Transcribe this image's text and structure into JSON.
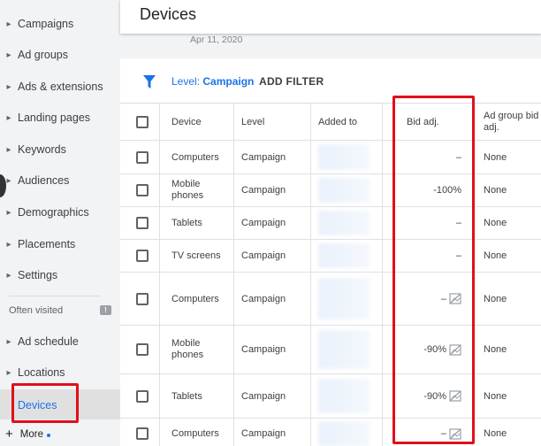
{
  "sidebar": {
    "items": [
      {
        "label": "Campaigns"
      },
      {
        "label": "Ad groups"
      },
      {
        "label": "Ads & extensions"
      },
      {
        "label": "Landing pages"
      },
      {
        "label": "Keywords"
      },
      {
        "label": "Audiences"
      },
      {
        "label": "Demographics"
      },
      {
        "label": "Placements"
      },
      {
        "label": "Settings"
      }
    ],
    "often_visited_label": "Often visited",
    "visited": [
      {
        "label": "Ad schedule"
      },
      {
        "label": "Locations"
      }
    ],
    "active_label": "Devices",
    "more_label": "More"
  },
  "header": {
    "title": "Devices",
    "date": "Apr 11, 2020"
  },
  "filter_bar": {
    "level_prefix": "Level:",
    "level_value": "Campaign",
    "add_filter": "ADD FILTER"
  },
  "table": {
    "columns": {
      "device": "Device",
      "level": "Level",
      "added_to": "Added to",
      "bid_adj": "Bid adj.",
      "ad_group_bid_line1": "Ad group bid",
      "ad_group_bid_line2": "adj."
    },
    "rows": [
      {
        "device": "Computers",
        "device2": "",
        "level": "Campaign",
        "bid": "–",
        "ad_group_bid": "None",
        "icon": false
      },
      {
        "device": "Mobile",
        "device2": "phones",
        "level": "Campaign",
        "bid": "-100%",
        "ad_group_bid": "None",
        "icon": false
      },
      {
        "device": "Tablets",
        "device2": "",
        "level": "Campaign",
        "bid": "–",
        "ad_group_bid": "None",
        "icon": false
      },
      {
        "device": "TV screens",
        "device2": "",
        "level": "Campaign",
        "bid": "–",
        "ad_group_bid": "None",
        "icon": false
      },
      {
        "device": "Computers",
        "device2": "",
        "level": "Campaign",
        "bid": "–",
        "ad_group_bid": "None",
        "icon": true
      },
      {
        "device": "Mobile",
        "device2": "phones",
        "level": "Campaign",
        "bid": "-90%",
        "ad_group_bid": "None",
        "icon": true
      },
      {
        "device": "Tablets",
        "device2": "",
        "level": "Campaign",
        "bid": "-90%",
        "ad_group_bid": "None",
        "icon": true
      },
      {
        "device": "Computers",
        "device2": "",
        "level": "Campaign",
        "bid": "–",
        "ad_group_bid": "None",
        "icon": true
      }
    ]
  },
  "colors": {
    "accent": "#1a73e8",
    "highlight": "#e0101a",
    "sidebar_bg": "#f1f3f4"
  }
}
